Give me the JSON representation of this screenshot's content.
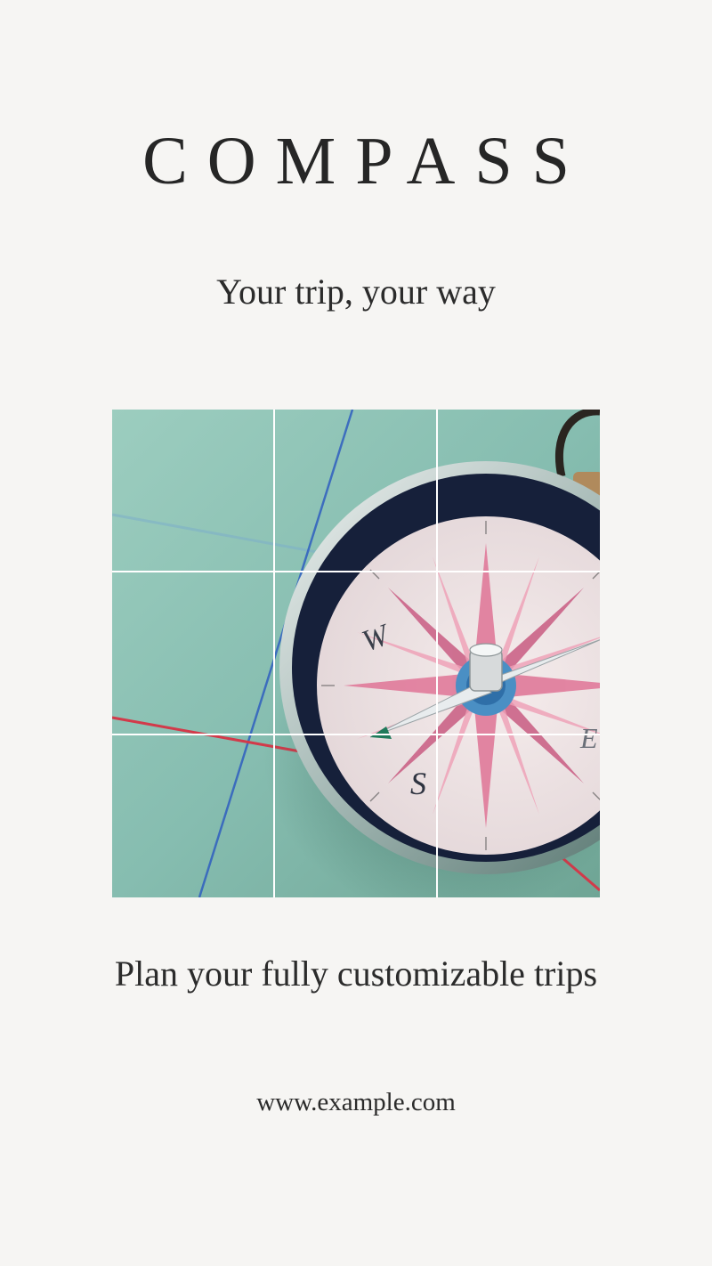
{
  "brand": {
    "title": "COMPASS"
  },
  "tagline": "Your trip, your way",
  "description": "Plan your fully customizable trips",
  "website": "www.example.com",
  "photo": {
    "subject": "compass-on-map-photo",
    "grid": "3x3"
  },
  "colors": {
    "background": "#f6f5f3",
    "text": "#2a2a2a",
    "map": "#8fc1b4",
    "rose_pink": "#e07a9a"
  }
}
